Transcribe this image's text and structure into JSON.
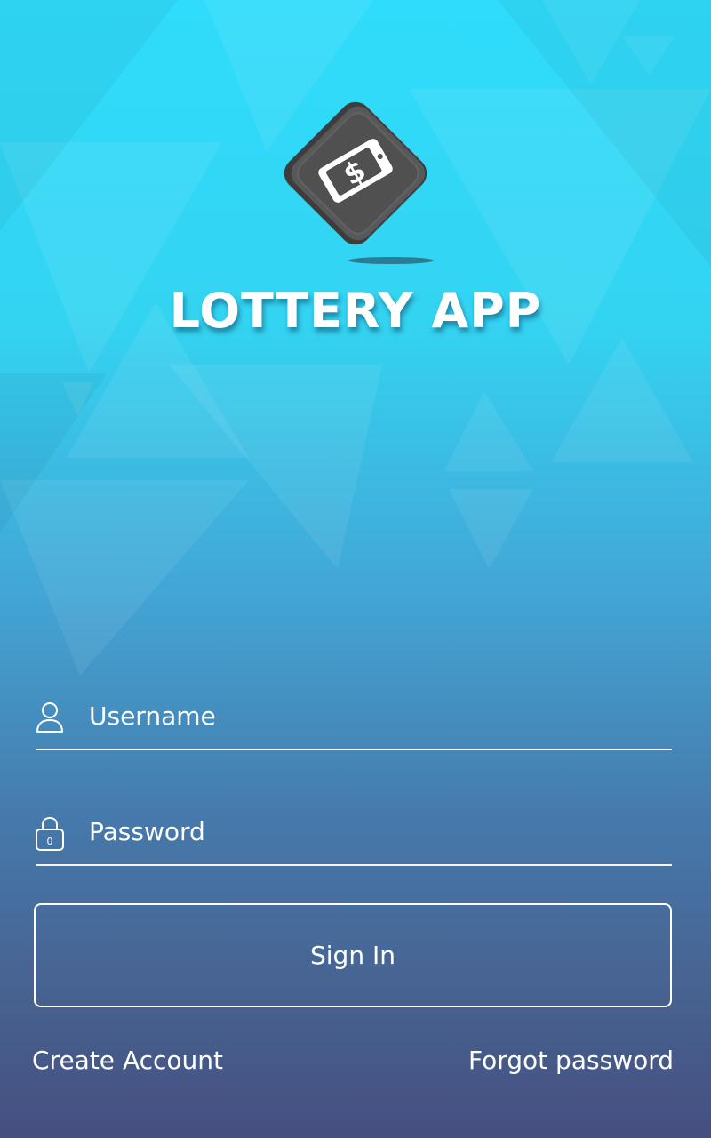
{
  "app": {
    "title": "LOTTERY APP",
    "logo_icon": "mobile-dollar-icon"
  },
  "form": {
    "username_placeholder": "Username",
    "password_placeholder": "Password",
    "username_icon": "user-icon",
    "password_icon": "lock-icon",
    "sign_in_label": "Sign In"
  },
  "links": {
    "create_account": "Create Account",
    "forgot_password": "Forgot password"
  },
  "colors": {
    "gradient_top": "#2fdcfb",
    "gradient_bottom": "#454f80",
    "logo_tile": "#4f4f4f",
    "text": "#ffffff"
  }
}
